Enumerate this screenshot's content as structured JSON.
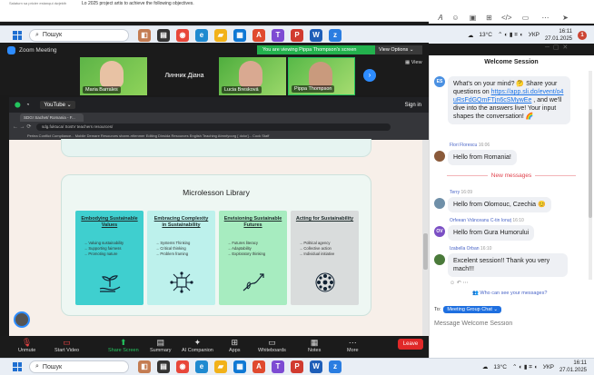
{
  "top_doc": {
    "left_text": "Salaturn sa pricier estanqui dwjekth",
    "text": "Lo 2025 project artis to achieve the following objectives."
  },
  "taskbar_top": {
    "search": "Пошук",
    "temp": "13°C",
    "lang": "УКР",
    "time": "16:11",
    "date": "27.01.2025",
    "badge": "1"
  },
  "zoom": {
    "title": "Zoom Meeting",
    "viewing": "You are viewing Pippa Thompson's screen",
    "view_options": "View Options",
    "view": "View",
    "participants": [
      {
        "name": "Maria Barrales"
      },
      {
        "name": "Линник Діана"
      },
      {
        "name": "Lucia Bresková"
      },
      {
        "name": "Pippa Thompson"
      }
    ],
    "toolbar": {
      "unmute": "Unmute",
      "start_video": "Start Video",
      "share_screen": "Share Screen",
      "summary": "Summary",
      "ai_companion": "AI Companion",
      "apps": "Apps",
      "whiteboards": "Whiteboards",
      "notes": "Notes",
      "more": "More",
      "leave": "Leave"
    }
  },
  "browser": {
    "youtube": "YouTube",
    "sign_in": "Sign in",
    "tab_title": "SDG! Sachet/ Romania - F...",
    "url": "sdg.fuktuca/ SostV teachers resources/",
    "bookmarks": "Perlea   Conflict Compliance...   Mobile   Demare Resources   sharm-rrltenmer   Editing   Dinsida Resources   English Teaching   Atmnfyoorg [ dolor]...   Cock Staff"
  },
  "page": {
    "library_title": "Microlesson Library",
    "cards": [
      {
        "title": "Embodying Sustainable Values",
        "items": [
          "Valuing sustainability",
          "Supporting fairness",
          "Promoting nature"
        ],
        "color": "#3fcfcf"
      },
      {
        "title": "Embracing Complexity in Sustainability",
        "items": [
          "Systems Thinking",
          "Critical thinking",
          "Problem framing"
        ],
        "color": "#bdf1ec"
      },
      {
        "title": "Envisioning Sustainable Futures",
        "items": [
          "Futures literacy",
          "Adaptability",
          "Exploratory thinking"
        ],
        "color": "#a7ecc0"
      },
      {
        "title": "Acting for Sustainability",
        "items": [
          "Political agency",
          "Collective action",
          "Individual initiative"
        ],
        "color": "#d9dcdc"
      }
    ]
  },
  "chat": {
    "title": "Welcome Session",
    "messages": [
      {
        "initials": "ES",
        "text_before": "What's on your mind? 🤔 Share your questions on ",
        "link": "https://app.sli.do/event/o4uRsFdGQmFTjn6cSMywEe",
        "text_after": " , and we'll dive into the answers live! Your input shapes the conversation! 🌈"
      },
      {
        "sender": "Flori Florescu",
        "time": "16:06",
        "text": "Hello from Romania!"
      },
      {
        "divider": "New messages"
      },
      {
        "sender": "Terry",
        "time": "16:09",
        "text": "Hello from Olomouc, Czechia 😊"
      },
      {
        "sender": "Orfeean Vrânceanu C-tin Ionuț",
        "time": "16:10",
        "initials": "OV",
        "text": "Hello from Gura Humorului"
      },
      {
        "sender": "Izabella Orban",
        "time": "16:10",
        "text": "Excelent session!! Thank you very mach!!!"
      }
    ],
    "who_can_see": "Who can see your messages?",
    "to_label": "To:",
    "to_target": "Meeting Group Chat",
    "input_placeholder": "Message Welcome Session"
  },
  "taskbar_bottom": {
    "search": "Пошук",
    "temp": "13°C",
    "lang": "УКР",
    "time": "16:11",
    "date": "27.01.2025"
  }
}
